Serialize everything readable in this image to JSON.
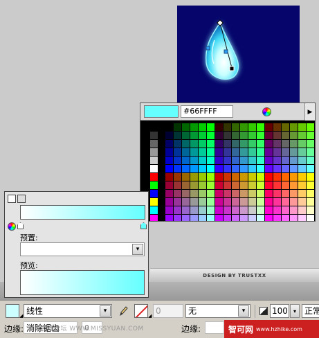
{
  "swatch_popup": {
    "hex_value": "#66FFFF",
    "preview_color": "#66ffff",
    "menu_arrow": "▶"
  },
  "gradient_panel": {
    "preset_label": "预置:",
    "preview_label": "预览:",
    "start_color": "#ffffff",
    "end_color": "#66ffff"
  },
  "canvas": {
    "background": "#05056b",
    "banner_text": "DESIGN BY TRUSTXX"
  },
  "properties": {
    "fill_type": "线性",
    "stroke_width": "0",
    "stroke_style": "无",
    "opacity": "100",
    "blend_mode": "正常",
    "edge_label": "边缘:",
    "edge_mode": "消除锯齿",
    "edge_value": "0",
    "edge_label_2": "边缘:"
  },
  "watermark": {
    "mid_text": "思缘设计论坛  WWW.MISSYUAN.COM",
    "right_text": "智可网",
    "right_url": "www.hzhike.com"
  },
  "icons": {
    "wheel": "color-wheel-icon",
    "pencil": "pencil-icon",
    "dropdown": "▾"
  }
}
